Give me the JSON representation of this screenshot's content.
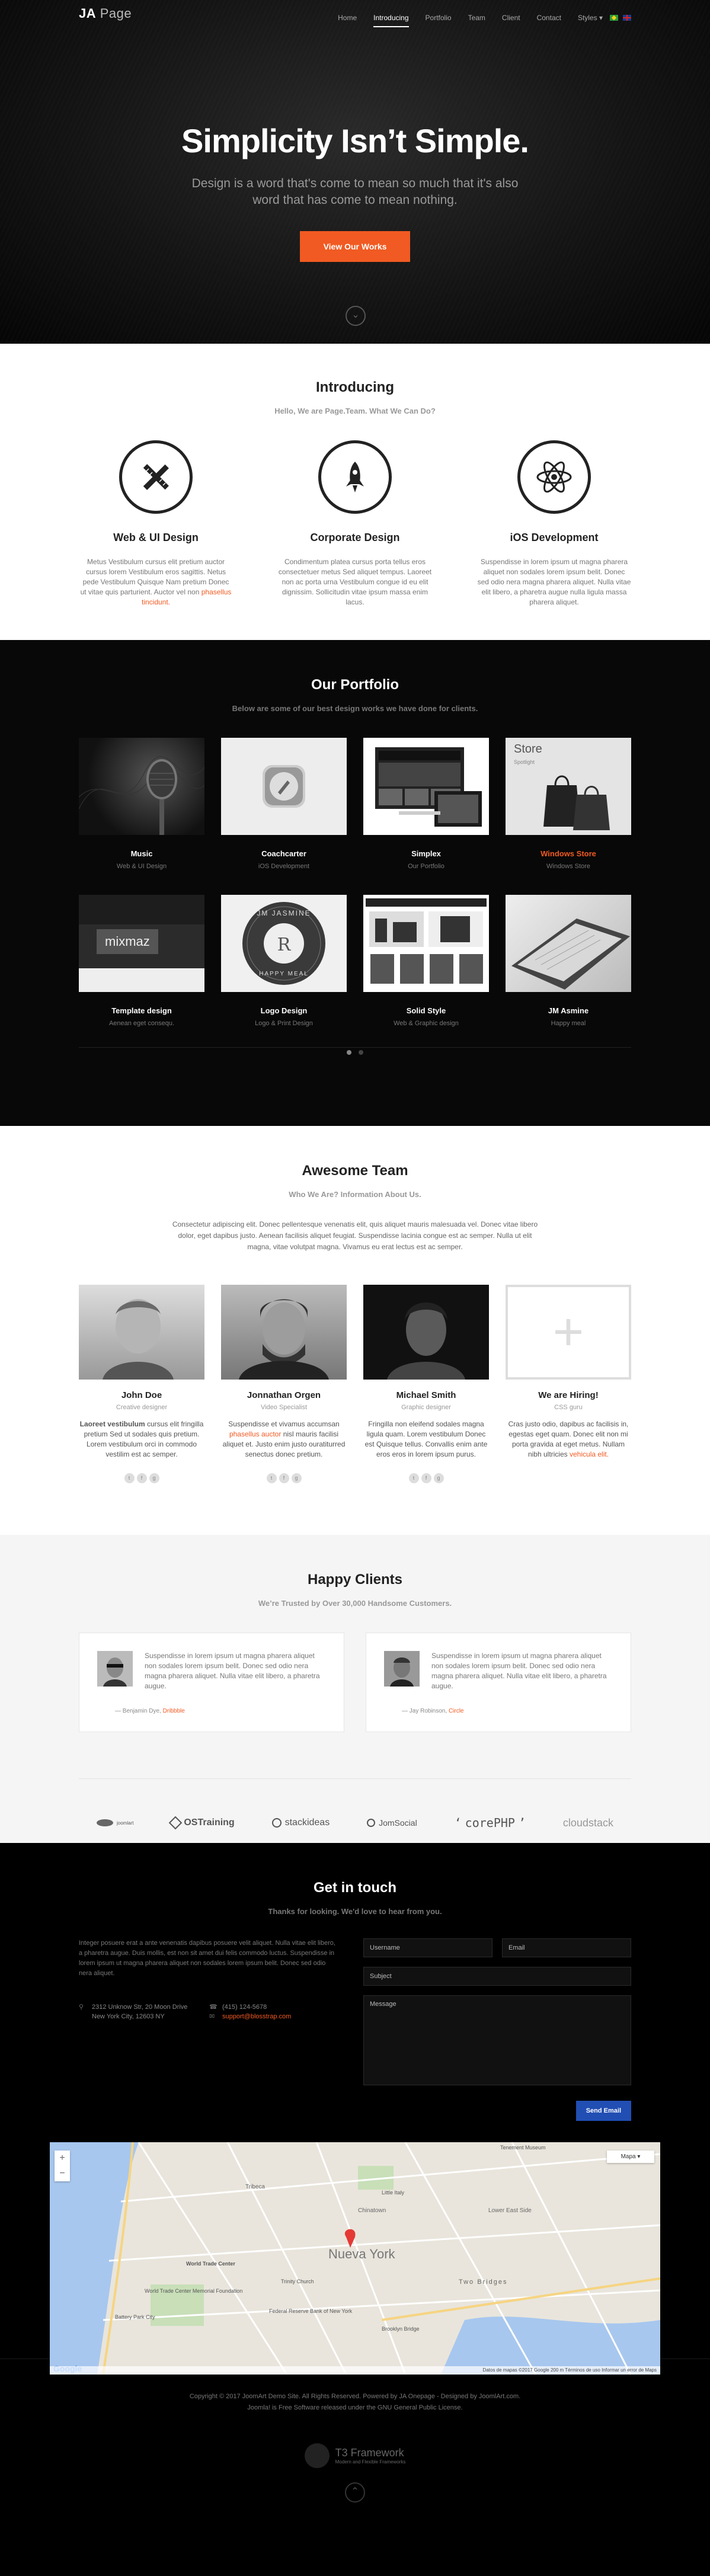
{
  "header": {
    "logo_bold": "JA",
    "logo_light": "Page",
    "nav": [
      "Home",
      "Introducing",
      "Portfolio",
      "Team",
      "Client",
      "Contact",
      "Styles ▾"
    ]
  },
  "hero": {
    "title": "Simplicity Isn’t Simple.",
    "subtitle": "Design is a word that's come to mean so much that it's also word that has come to mean nothing.",
    "cta": "View Our Works"
  },
  "intro": {
    "title": "Introducing",
    "subtitle": "Hello, We are Page.Team. What We Can Do?",
    "services": [
      {
        "title": "Web & UI Design",
        "text": "Metus Vestibulum cursus elit pretium auctor cursus lorem Vestibulum eros sagittis. Netus pede Vestibulum Quisque Nam pretium Donec ut vitae quis parturient. Auctor vel non",
        "link": "phasellus tincidunt."
      },
      {
        "title": "Corporate Design",
        "text": "Condimentum platea cursus porta tellus eros consectetuer metus Sed aliquet tempus. Laoreet non ac porta urna Vestibulum congue id eu elit dignissim. Sollicitudin vitae ipsum massa enim lacus.",
        "link": ""
      },
      {
        "title": "iOS Development",
        "text": "Suspendisse in lorem ipsum ut magna pharera aliquet non sodales lorem ipsum belit. Donec sed odio nera magna pharera aliquet. Nulla vitae elit libero, a pharetra augue nulla ligula massa pharera aliquet.",
        "link": ""
      }
    ]
  },
  "portfolio": {
    "title": "Our Portfolio",
    "subtitle": "Below are some of our best design works we have done for clients.",
    "items": [
      {
        "title": "Music",
        "cat": "Web & UI Design"
      },
      {
        "title": "Coachcarter",
        "cat": "iOS Development"
      },
      {
        "title": "Simplex",
        "cat": "Our Portfolio"
      },
      {
        "title": "Windows Store",
        "cat": "Windows Store"
      },
      {
        "title": "Template design",
        "cat": "Aenean eget consequ."
      },
      {
        "title": "Logo Design",
        "cat": "Logo & Print Design"
      },
      {
        "title": "Solid Style",
        "cat": "Web & Graphic design"
      },
      {
        "title": "JM Asmine",
        "cat": "Happy meal"
      }
    ],
    "thumb_text": {
      "store": "Store",
      "spotlight": "Spotlight",
      "mixmaz": "mixmaz",
      "jm_top": "JM JASMINE",
      "jm_bottom": "HAPPY MEAL"
    }
  },
  "team": {
    "title": "Awesome Team",
    "subtitle": "Who We Are? Information About Us.",
    "intro": "Consectetur adipiscing elit. Donec pellentesque venenatis elit, quis aliquet mauris malesuada vel. Donec vitae libero dolor, eget dapibus justo. Aenean facilisis aliquet feugiat. Suspendisse lacinia congue est ac semper. Nulla ut elit magna, vitae volutpat magna. Vivamus eu erat lectus est ac semper.",
    "members": [
      {
        "name": "John Doe",
        "role": "Creative designer",
        "lead": "Laoreet vestibulum",
        "text": "cursus elit fringilla pretium Sed ut sodales quis pretium. Lorem vestibulum orci in commodo vestilim est ac semper.",
        "link": ""
      },
      {
        "name": "Jonnathan Orgen",
        "role": "Video Specialist",
        "lead": "",
        "text": "Suspendisse et vivamus accumsan",
        "link": "phasellus auctor",
        "text2": "nisl mauris facilisi aliquet et. Justo enim justo ouratiturred senectus donec pretium."
      },
      {
        "name": "Michael Smith",
        "role": "Graphic designer",
        "lead": "",
        "text": "Fringilla non eleifend sodales magna ligula quam. Lorem vestibulum Donec est Quisque tellus. Convallis enim ante eros eros in lorem ipsum purus.",
        "link": ""
      },
      {
        "name": "We are Hiring!",
        "role": "CSS guru",
        "lead": "",
        "text": "Cras justo odio, dapibus ac facilisis in, egestas eget quam. Donec elit non mi porta gravida at eget metus. Nullam nibh ultricies",
        "link": "vehicula elit."
      }
    ]
  },
  "clients": {
    "title": "Happy Clients",
    "subtitle": "We’re Trusted by Over 30,000 Handsome Customers.",
    "testimonials": [
      {
        "text": "Suspendisse in lorem ipsum ut magna pharera aliquet non sodales lorem ipsum belit. Donec sed odio nera magna pharera aliquet. Nulla vitae elit libero, a pharetra augue.",
        "author": "— Benjamin Dye,",
        "company": "Dribbble"
      },
      {
        "text": "Suspendisse in lorem ipsum ut magna pharera aliquet non sodales lorem ipsum belit. Donec sed odio nera magna pharera aliquet. Nulla vitae elit libero, a pharetra augue.",
        "author": "— Jay Robinson,",
        "company": "Circle"
      }
    ],
    "logos": [
      "joomlart",
      "OSTraining",
      "stackideas",
      "JomSocial",
      "corePHP",
      "cloudstack"
    ]
  },
  "contact": {
    "title": "Get in touch",
    "subtitle": "Thanks for looking. We'd love to hear from you.",
    "text": "Integer posuere erat a ante venenatis dapibus posuere velit aliquet. Nulla vitae elit libero, a pharetra augue. Duis mollis, est non sit amet dui felis commodo luctus. Suspendisse in lorem ipsum ut magna pharera aliquet non sodales lorem ipsum belit. Donec sed odio nera aliquet.",
    "address1": "2312 Unknow Str, 20 Moon Drive",
    "address2": "New York City, 12603 NY",
    "phone": "(415) 124-5678",
    "email": "support@blosstrap.com",
    "placeholders": {
      "username": "Username",
      "email": "Email",
      "subject": "Subject",
      "message": "Message"
    },
    "send": "Send Email",
    "map": {
      "type": "Mapa",
      "city": "Nueva York",
      "footer": "Datos de mapas ©2017 Google   200 m   Términos de uso   Informar un error de Maps",
      "labels": [
        "World Trade Center",
        "World Trade Center Memorial Foundation",
        "Battery Park City",
        "Tribeca",
        "Two Bridges",
        "Brooklyn Bridge",
        "Tenement Museum",
        "Federal Reserve Bank of New York",
        "Trinity Church",
        "Chinatown",
        "Little Italy",
        "Lower East Side"
      ]
    }
  },
  "footer": {
    "line1": "Copyright © 2017 JoomArt Demo Site. All Rights Reserved. Powered by JA Onepage - Designed by JoomlArt.com.",
    "line2": "Joomla! is Free Software released under the GNU General Public License.",
    "fw_title": "T3 Framework",
    "fw_sub": "Modern and Flexible Frameworks"
  }
}
